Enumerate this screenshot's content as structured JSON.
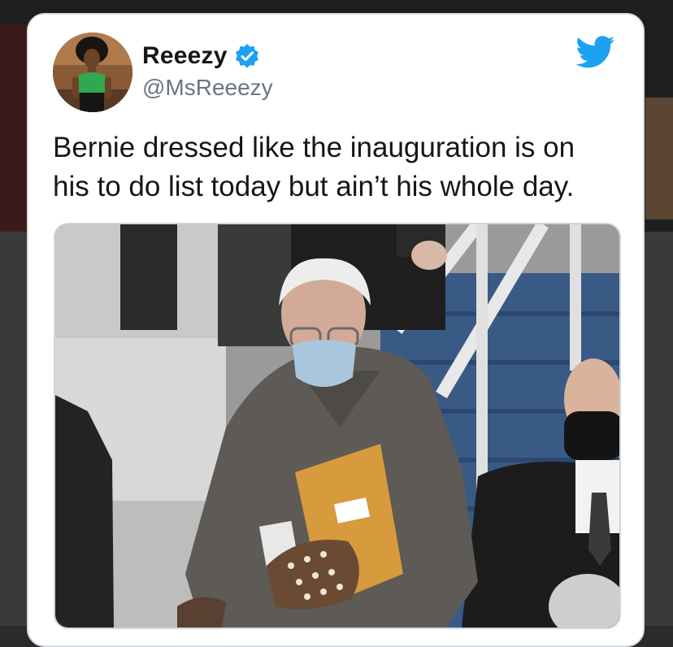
{
  "tweet": {
    "display_name": "Reeezy",
    "handle": "@MsReeezy",
    "text": "Bernie dressed like the inauguration is on\nhis to do list today but ain’t his whole day.",
    "verified": true
  },
  "icons": {
    "verified": "verified-badge-icon",
    "brand": "twitter-bird-icon"
  },
  "colors": {
    "brand_blue": "#1da1f2",
    "name_text": "#14171a",
    "handle_text": "#657786",
    "card_border": "#d9dfe4"
  }
}
